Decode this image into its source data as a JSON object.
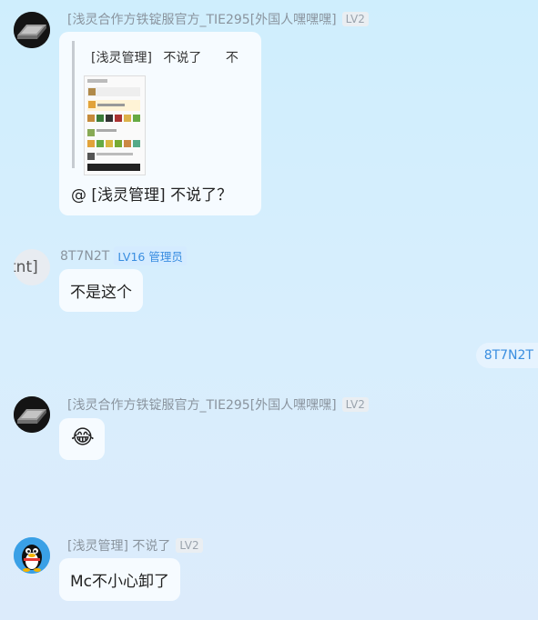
{
  "messages": [
    {
      "sender": "[浅灵合作方铁锭服官方_TIE295[外国人嘿嘿嘿]",
      "level": "LV2",
      "quote": {
        "author": "[浅灵管理]",
        "name": "不说了",
        "text": "不"
      },
      "text": "@ [浅灵管理]  不说了？"
    },
    {
      "sender": "8T7N2T",
      "avatar_text": "tnt]",
      "level": "LV16",
      "role": "管理员",
      "text": "不是这个"
    },
    {
      "sender": "[浅灵合作方铁锭服官方_TIE295[外国人嘿嘿嘿]",
      "level": "LV2",
      "emoji": "😂"
    },
    {
      "sender": "[浅灵管理]  不说了",
      "level": "LV2",
      "text": "Mc不小心卸了"
    }
  ],
  "self_tag": "8T7N2T",
  "icons": {
    "metal_avatar": "iron-ingot-icon",
    "qq_avatar": "qq-penguin-icon"
  }
}
